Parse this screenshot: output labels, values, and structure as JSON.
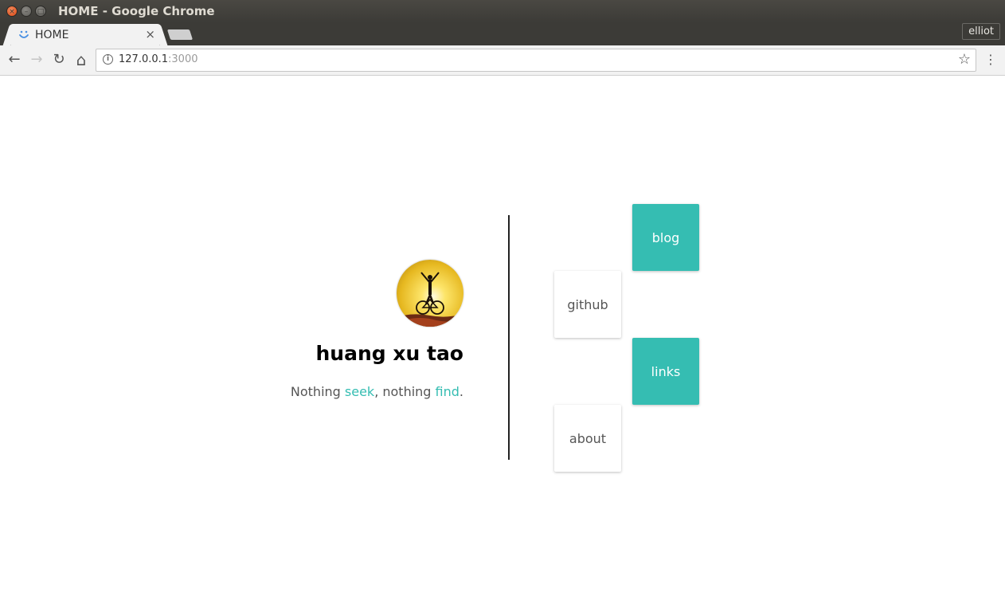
{
  "window": {
    "title": "HOME - Google Chrome"
  },
  "tab": {
    "title": "HOME",
    "close": "×"
  },
  "profile": {
    "name": "elliot"
  },
  "toolbar": {
    "url_host": "127.0.0.1",
    "url_port": ":3000",
    "back_icon": "←",
    "forward_icon": "→",
    "reload_icon": "↻",
    "home_icon": "⌂",
    "star_icon": "☆",
    "menu_icon": "⋮"
  },
  "profile_card": {
    "name": "huang xu tao",
    "motto_parts": [
      "Nothing ",
      "seek",
      ", nothing ",
      "find",
      "."
    ]
  },
  "tiles": {
    "blog": "blog",
    "github": "github",
    "links": "links",
    "about": "about"
  },
  "colors": {
    "accent": "#35bdb2",
    "titlebar": "#3c3b37"
  }
}
